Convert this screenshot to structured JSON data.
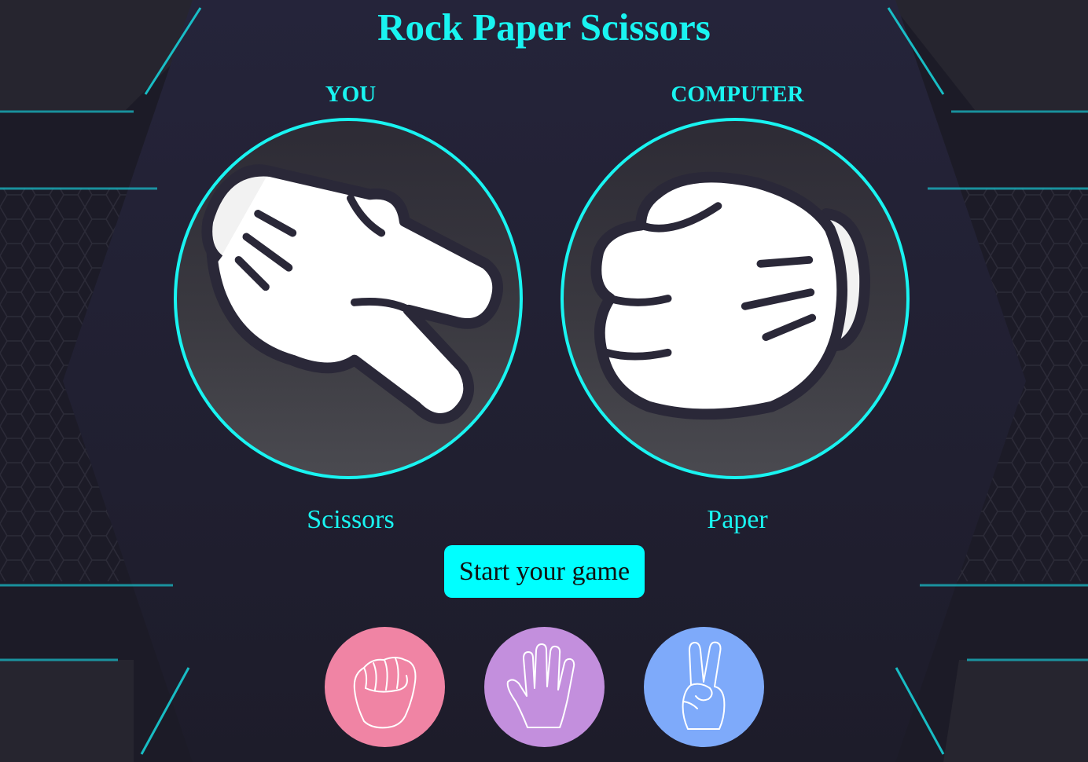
{
  "app": {
    "title": "Rock Paper Scissors"
  },
  "players": {
    "you": {
      "label": "YOU",
      "choice": "Scissors"
    },
    "computer": {
      "label": "COMPUTER",
      "choice": "Paper"
    }
  },
  "start_button": {
    "label": "Start your game"
  },
  "options": [
    {
      "name": "rock",
      "icon": "fist-icon",
      "color": "#f084a4"
    },
    {
      "name": "paper",
      "icon": "open-hand-icon",
      "color": "#c38fdd"
    },
    {
      "name": "scissors",
      "icon": "peace-hand-icon",
      "color": "#7eaafa"
    }
  ],
  "colors": {
    "accent": "#19f4f1",
    "background": "#1f1e2a",
    "button": "#00ffff"
  }
}
